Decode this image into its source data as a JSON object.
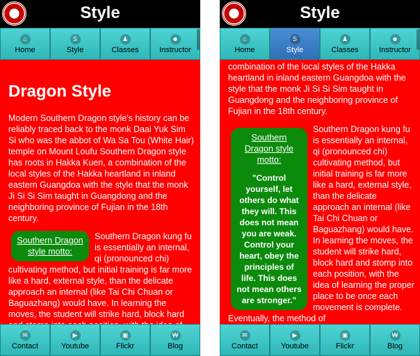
{
  "header": {
    "title": "Style"
  },
  "top_nav": [
    {
      "label": "Home",
      "icon": "home-icon",
      "glyph": "⌂"
    },
    {
      "label": "Style",
      "icon": "style-icon",
      "glyph": "S"
    },
    {
      "label": "Classes",
      "icon": "bell-icon",
      "glyph": "♟"
    },
    {
      "label": "Instructor",
      "icon": "instructor-icon",
      "glyph": "☻"
    }
  ],
  "bottom_nav": [
    {
      "label": "Contact",
      "icon": "mail-icon",
      "glyph": "✉"
    },
    {
      "label": "Youtube",
      "icon": "youtube-icon",
      "glyph": "▶"
    },
    {
      "label": "Flickr",
      "icon": "flickr-icon",
      "glyph": "▣"
    },
    {
      "label": "Blog",
      "icon": "blog-icon",
      "glyph": "₩"
    }
  ],
  "content": {
    "heading": "Dragon Style",
    "intro_paragraph": "Modern Southern Dragon style's history can be reliably traced back to the monk Daai Yuk Sim Si who was the abbot of Wa Sa Tou (White Hair) temple on Mount Loufu Southern Dragon style has roots in Hakka Kuen, a combination of the local styles of the Hakka heartland in inland eastern Guangdoa with the style that the monk Ji Si Si Sim taught in Guangdong and the neighboring province of Fujian in the 18th century.",
    "intro_tail": "combination of the local styles of the Hakka heartland in inland eastern Guangdoa with the style that the monk Ji Si Si Sim taught in Guangdong and the neighboring province of Fujian in the 18th century.",
    "motto_title": "Southern Dragon style motto:",
    "motto_quote": "\"Control yourself, let others do what they will. This does not mean you are weak. Control your heart, obey the principles of life. This does not mean others are stronger.\"",
    "kungfu_paragraph": "Southern Dragon kung fu is essentially an internal, qi (pronounced chi) cultivating method, but initial training is far more like a hard, external style, than the delicate approach an internal (like Tai Chi Chuan or Baguazhang) would have. In learning the moves, the student will strike hard, block hard and stomp into each position, with the idea of learning the proper place to be once each movement is complete. Eventually, the method of"
  },
  "colors": {
    "background": "#ff0000",
    "header": "#000000",
    "nav": "#38c8c8",
    "nav_active": "#3f84cc",
    "motto_box": "#0b8a0b"
  }
}
